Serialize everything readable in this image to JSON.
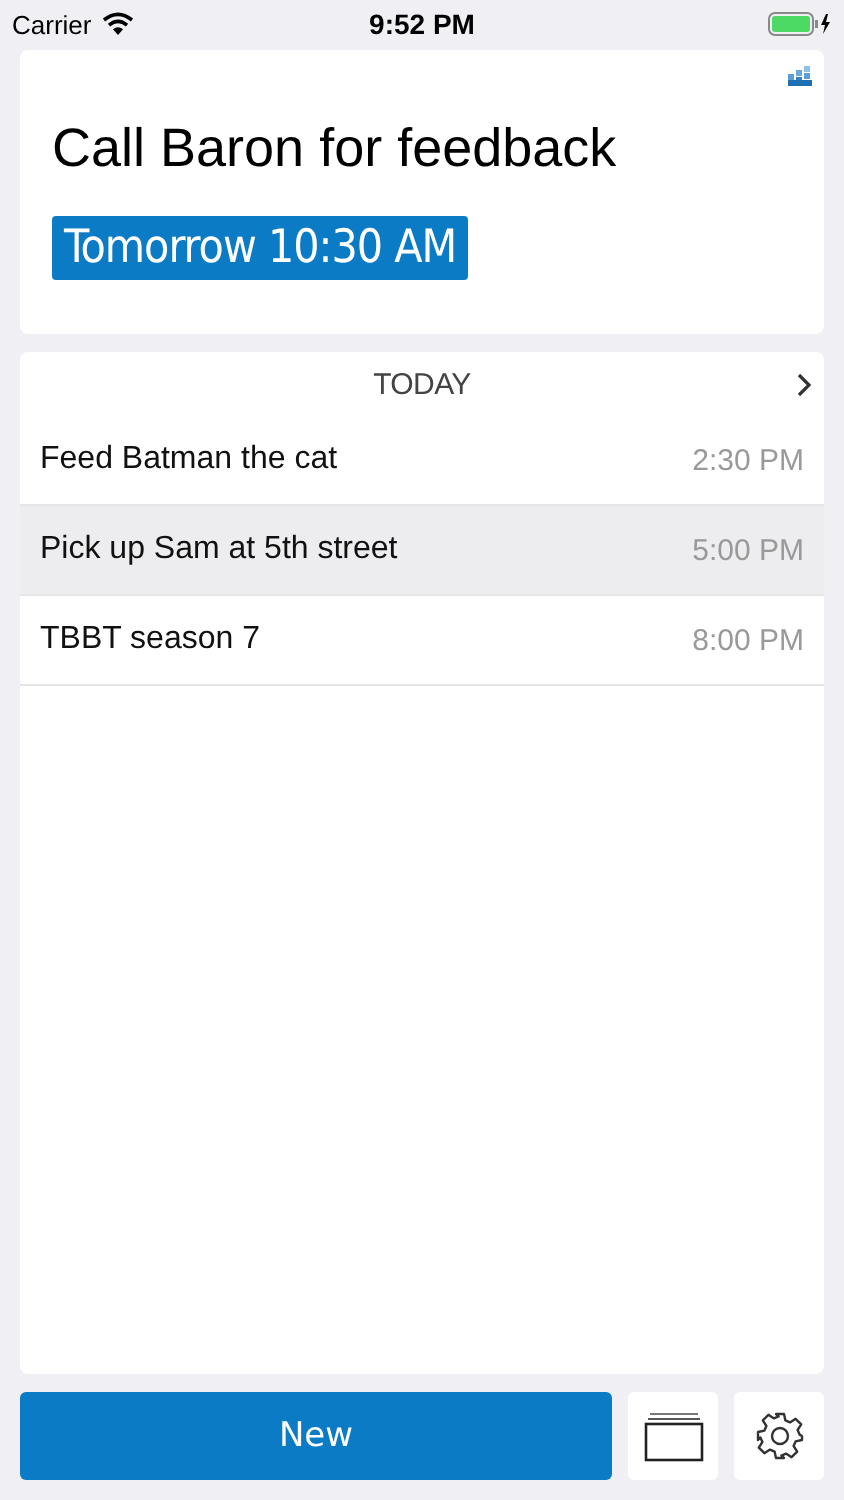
{
  "status_bar": {
    "carrier": "Carrier",
    "time": "9:52 PM"
  },
  "reminder": {
    "title": "Call Baron for feedback",
    "due": "Tomorrow 10:30 AM"
  },
  "list": {
    "heading": "TODAY",
    "items": [
      {
        "title": "Feed Batman the cat",
        "time": "2:30 PM",
        "selected": false
      },
      {
        "title": "Pick up Sam at 5th street",
        "time": "5:00 PM",
        "selected": true
      },
      {
        "title": "TBBT season 7",
        "time": "8:00 PM",
        "selected": false
      }
    ]
  },
  "toolbar": {
    "new_label": "New"
  }
}
